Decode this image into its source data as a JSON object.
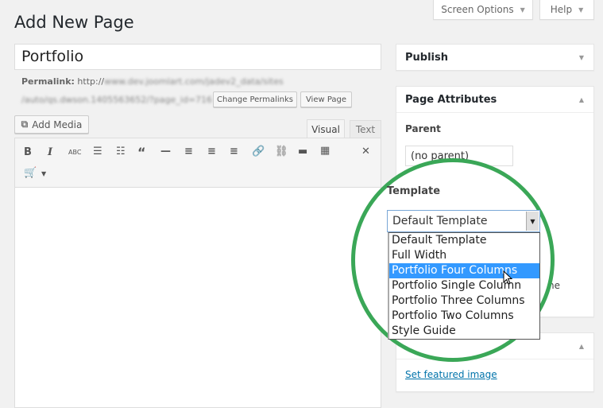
{
  "header": {
    "screen_options": "Screen Options",
    "help": "Help",
    "page_title": "Add New Page"
  },
  "post": {
    "title": "Portfolio",
    "permalink_label": "Permalink:",
    "permalink_prefix": "http://",
    "permalink_blurred_1": "www.dev.joomlart.com/jadev2_data/sites",
    "permalink_blurred_2": "/auto/qs.dwson.1405563652/?page_id=716",
    "change_permalinks": "Change Permalinks",
    "view_page": "View Page"
  },
  "editor": {
    "add_media": "Add Media",
    "tabs": [
      {
        "label": "Visual",
        "active": true
      },
      {
        "label": "Text",
        "active": false
      }
    ],
    "toolbar": [
      "bold",
      "italic",
      "strikethrough",
      "bullet-list",
      "numbered-list",
      "blockquote",
      "horizontal-rule",
      "align-left",
      "align-center",
      "align-right",
      "link",
      "unlink",
      "read-more",
      "toolbar-toggle",
      "fullscreen",
      "cart"
    ]
  },
  "sidebar": {
    "publish": {
      "title": "Publish"
    },
    "page_attributes": {
      "title": "Page Attributes",
      "parent_label": "Parent",
      "parent_value": "(no parent)",
      "template_label": "Template",
      "template_value": "Default Template",
      "template_options": [
        "Default Template",
        "Full Width",
        "Portfolio Four Columns",
        "Portfolio Single Column",
        "Portfolio Three Columns",
        "Portfolio Two Columns",
        "Style Guide"
      ],
      "highlighted_option": "Portfolio Four Columns",
      "partial_text": "ne"
    },
    "featured_image": {
      "link": "Set featured image"
    }
  },
  "colors": {
    "highlight": "#3399ff",
    "circle": "#3aa757",
    "link": "#0073aa"
  }
}
